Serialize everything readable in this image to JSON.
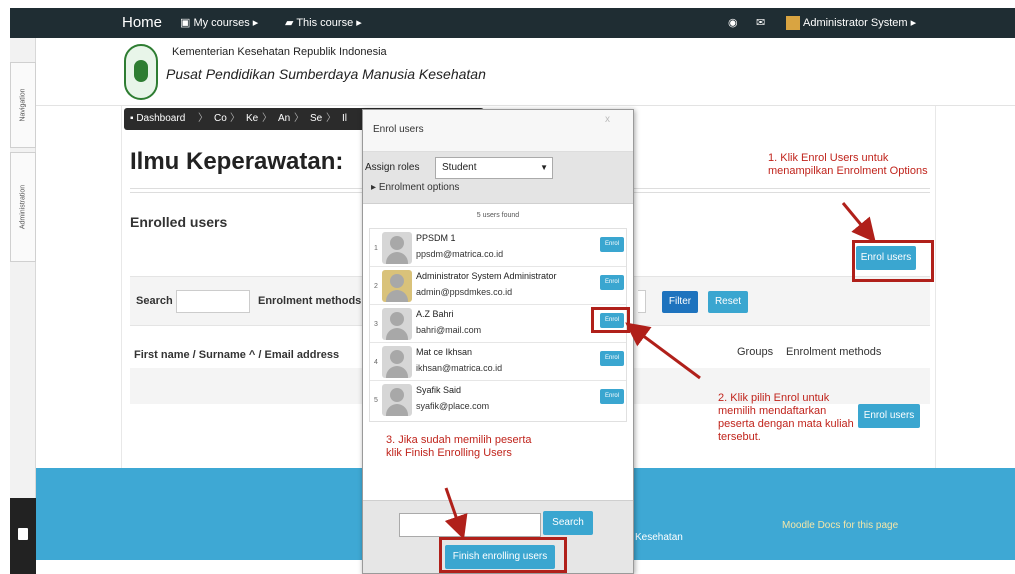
{
  "topbar": {
    "home": "Home",
    "my_courses": "My courses",
    "this_course": "This course",
    "user_name": "Administrator System"
  },
  "dock": {
    "navigation": "Navigation",
    "administration": "Administration"
  },
  "header": {
    "org_line1": "Kementerian Kesehatan Republik Indonesia",
    "org_line2": "Pusat Pendidikan Sumberdaya Manusia Kesehatan"
  },
  "breadcrumb": [
    "Dashboard",
    "Co",
    "Ke",
    "An",
    "Se",
    "Il"
  ],
  "course": {
    "title": "Ilmu Keperawatan:",
    "enrolled_heading": "Enrolled users"
  },
  "filter": {
    "search_label": "Search",
    "methods_label": "Enrolment methods",
    "filter_button": "Filter",
    "reset_button": "Reset"
  },
  "table": {
    "name_header": "First name / Surname ^ / Email address",
    "groups_header": "Groups",
    "methods_header": "Enrolment methods"
  },
  "buttons": {
    "enrol_users": "Enrol users"
  },
  "dialog": {
    "title": "Enrol users",
    "close": "x",
    "assign_roles_label": "Assign roles",
    "role_value": "Student",
    "enrolment_options": "Enrolment options",
    "users_found": "5 users found",
    "enrol_label": "Enrol",
    "search_button": "Search",
    "finish_button": "Finish enrolling users",
    "users": [
      {
        "index": "1",
        "name": "PPSDM 1",
        "email": "ppsdm@matrica.co.id"
      },
      {
        "index": "2",
        "name": "Administrator System Administrator",
        "email": "admin@ppsdmkes.co.id"
      },
      {
        "index": "3",
        "name": "A.Z Bahri",
        "email": "bahri@mail.com"
      },
      {
        "index": "4",
        "name": "Mat ce Ikhsan",
        "email": "ikhsan@matrica.co.id"
      },
      {
        "index": "5",
        "name": "Syafik Said",
        "email": "syafik@place.com"
      }
    ]
  },
  "footer": {
    "text": "Kesehatan",
    "docs_link": "Moodle Docs for this page"
  },
  "annotations": {
    "step1": [
      "1. Klik Enrol Users untuk",
      "menampilkan Enrolment Options"
    ],
    "step2": [
      "2. Klik pilih Enrol untuk",
      "memilih mendaftarkan",
      "peserta dengan mata kuliah",
      "tersebut."
    ],
    "step3": [
      "3. Jika sudah memilih peserta",
      "klik Finish Enrolling Users"
    ],
    "color": "#c0241c"
  },
  "colors": {
    "topbar": "#1f2d33",
    "footer": "#3ea8d4",
    "button": "#3aa6d0",
    "filter_button": "#1e73be",
    "highlight": "#b0201a"
  }
}
